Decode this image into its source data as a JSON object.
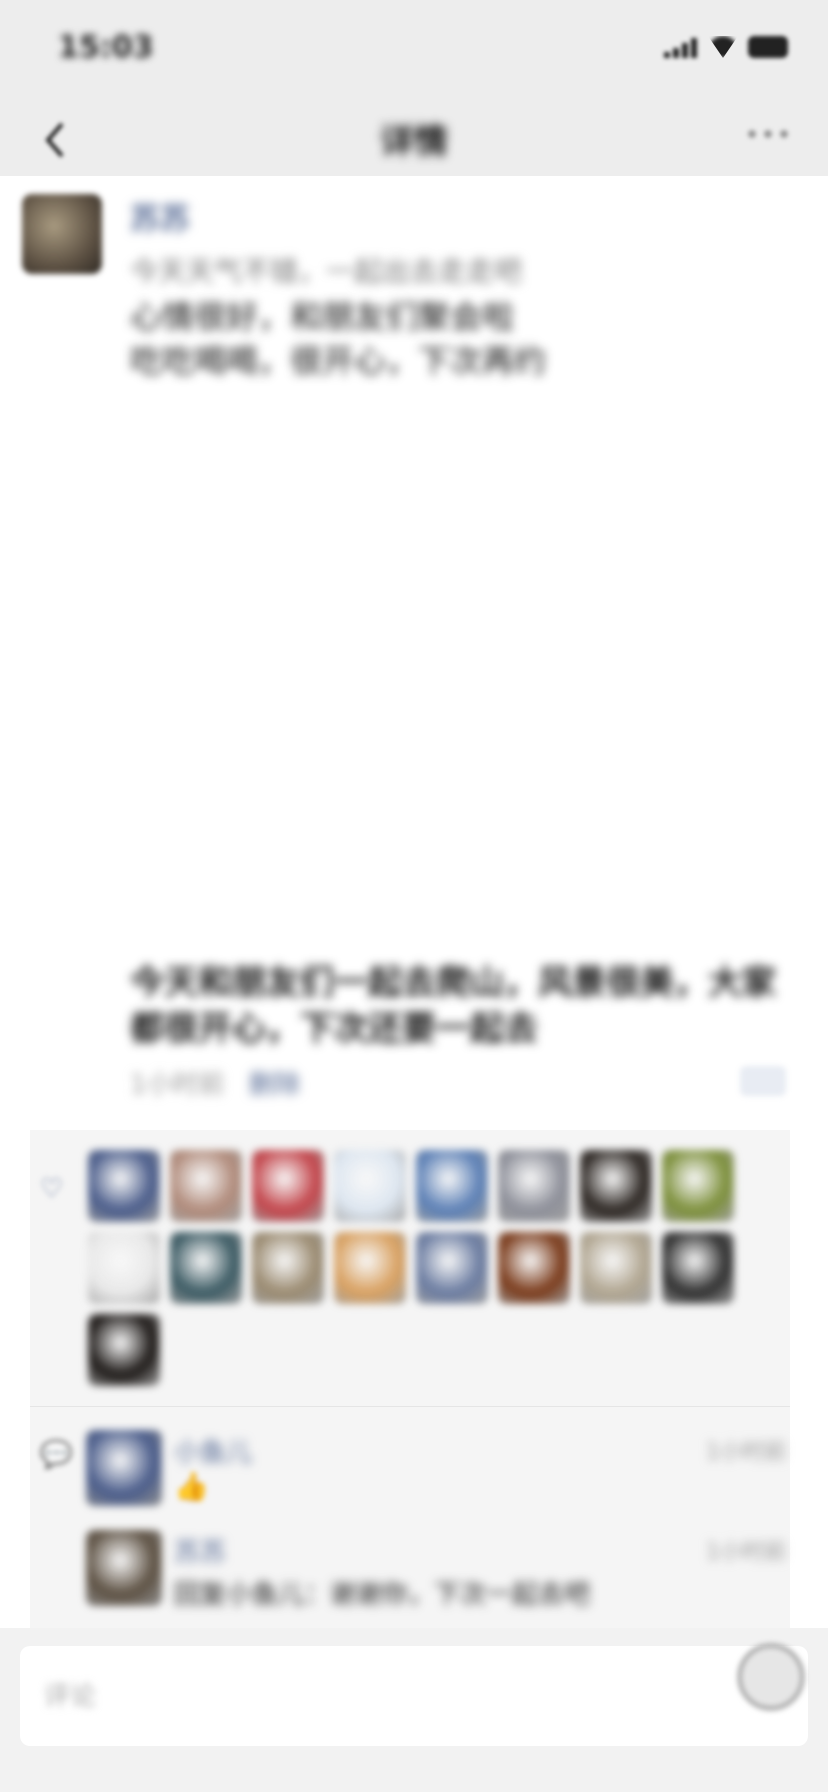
{
  "status_bar": {
    "time": "15:03"
  },
  "nav": {
    "title": "详情"
  },
  "post": {
    "author": "苏苏",
    "line1": "今天天气不错，一起出去走走吧",
    "line2": "心情很好，和朋友们聚会啦",
    "line3": "吃吃喝喝，很开心，下次再约",
    "caption": "今天和朋友们一起去爬山，风景很美，大家都很开心，下次还要一起去",
    "time": "1小时前",
    "delete_label": "删除"
  },
  "likes": {
    "avatar_colors": [
      "#4a5c8a",
      "#b08a7a",
      "#c2444a",
      "#dde6f0",
      "#5b7fb5",
      "#8d8f99",
      "#2c2622",
      "#7c8f3a",
      "#e8e8e8",
      "#3b5a63",
      "#9a8a70",
      "#d8a060",
      "#6a7ba0",
      "#7a3a1a",
      "#b0a590",
      "#2f2f2f",
      "#1e1a18"
    ]
  },
  "comments": [
    {
      "name": "小鱼儿",
      "time": "1小时前",
      "text": "",
      "emoji": "👍",
      "avatar_color": "#4a5c8a"
    },
    {
      "name": "苏苏",
      "time": "1小时前",
      "text": "回复小鱼儿：谢谢你，下次一起去吧",
      "emoji": "",
      "avatar_color": "#5d5143"
    }
  ],
  "input": {
    "placeholder": "评论"
  }
}
